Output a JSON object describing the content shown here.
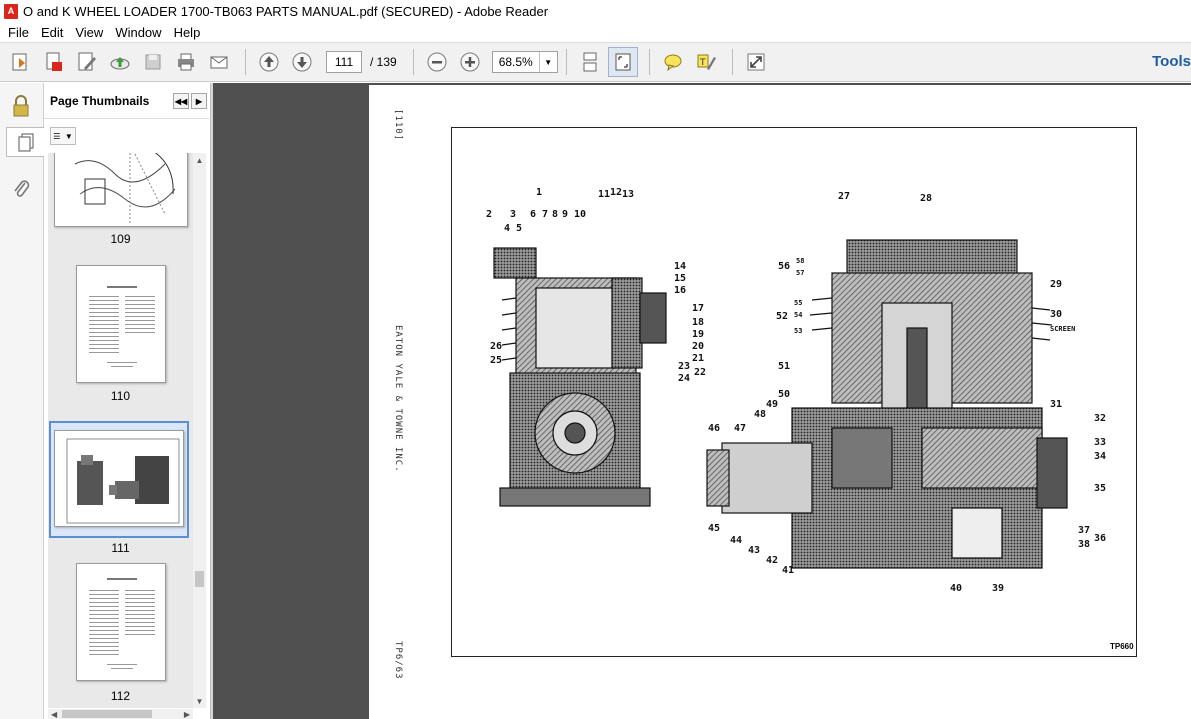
{
  "window": {
    "title": "O and K WHEEL LOADER 1700-TB063 PARTS MANUAL.pdf (SECURED) - Adobe Reader",
    "app_icon_text": "A"
  },
  "menu": [
    "File",
    "Edit",
    "View",
    "Window",
    "Help"
  ],
  "toolbar": {
    "page_current": "111",
    "page_total": "/ 139",
    "zoom": "68.5%",
    "tools_label": "Tools"
  },
  "panel": {
    "title": "Page Thumbnails"
  },
  "thumbnails": [
    {
      "label": "109"
    },
    {
      "label": "110"
    },
    {
      "label": "111",
      "selected": true
    },
    {
      "label": "112"
    }
  ],
  "page": {
    "page_ref": "[110]",
    "publisher": "EATON YALE & TOWNE INC.",
    "footer_code": "TP660",
    "bottom_code": "TP6/63",
    "callouts": [
      "1",
      "2",
      "3",
      "4",
      "5",
      "6",
      "7",
      "8",
      "9",
      "10",
      "11",
      "12",
      "13",
      "14",
      "15",
      "16",
      "17",
      "18",
      "19",
      "20",
      "21",
      "22",
      "23",
      "24",
      "25",
      "26",
      "27",
      "28",
      "29",
      "30",
      "SCREEN",
      "31",
      "32",
      "33",
      "34",
      "35",
      "36",
      "37",
      "38",
      "39",
      "40",
      "41",
      "42",
      "43",
      "44",
      "45",
      "46",
      "47",
      "48",
      "49",
      "50",
      "51",
      "52",
      "53",
      "54",
      "55",
      "56",
      "57",
      "58"
    ]
  }
}
